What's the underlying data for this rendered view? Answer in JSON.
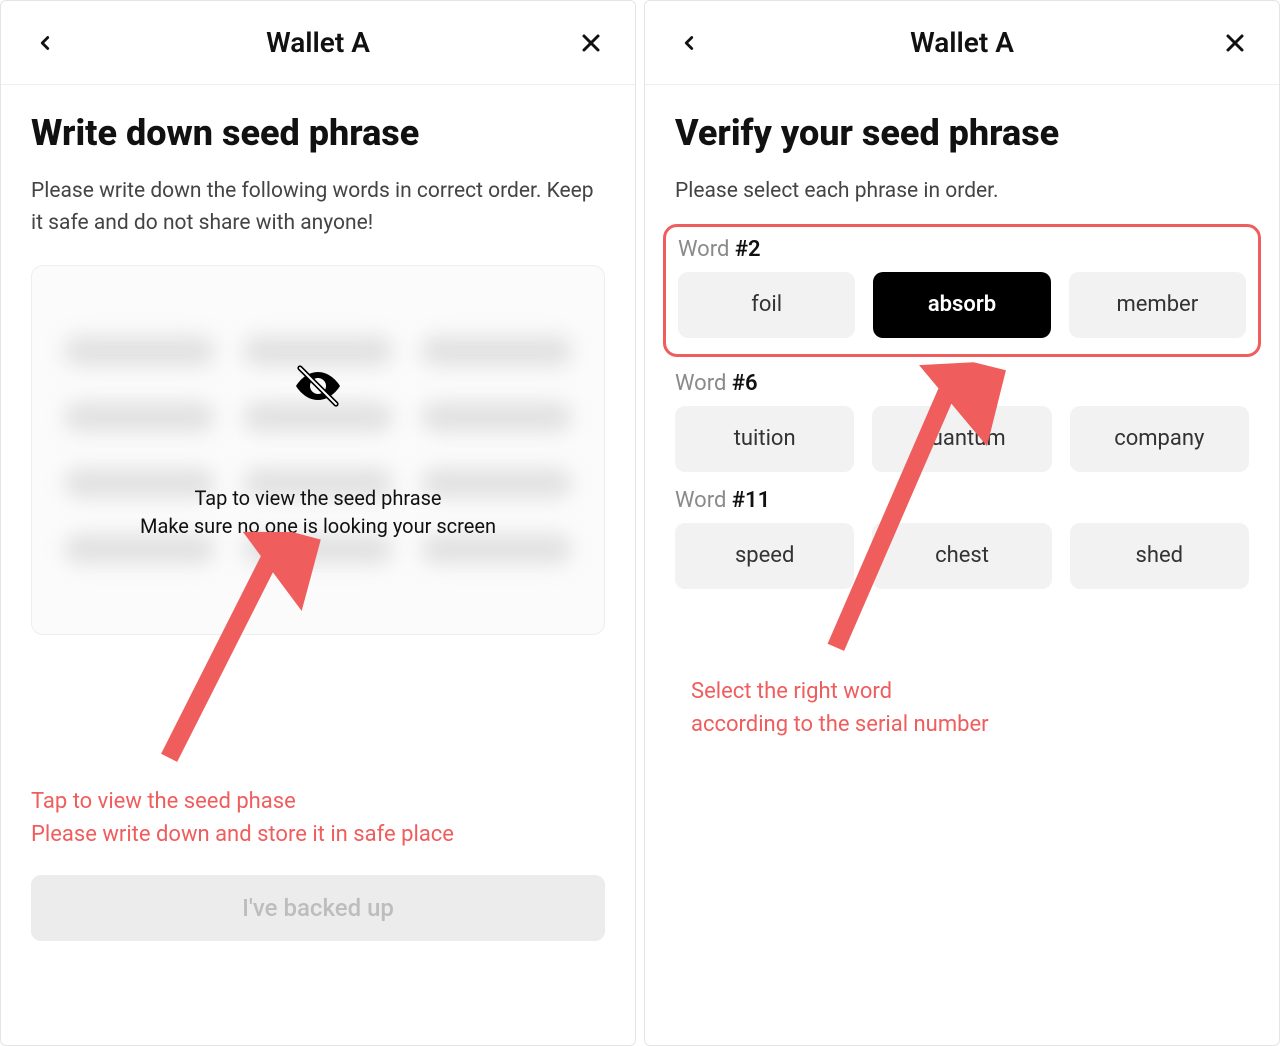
{
  "left": {
    "title": "Wallet A",
    "heading": "Write down seed phrase",
    "subtitle": "Please write down the following words in correct order. Keep it safe and do not share with anyone!",
    "tap_line1": "Tap to view the seed phrase",
    "tap_line2": "Make sure no one is looking your screen",
    "note_line1": "Tap to view the seed phase",
    "note_line2": "Please write down and store it in safe place",
    "button": "I've backed up"
  },
  "right": {
    "title": "Wallet A",
    "heading": "Verify your seed phrase",
    "subtitle": "Please select each phrase in order.",
    "groups": [
      {
        "label_prefix": "Word ",
        "label_num": "#2",
        "options": [
          "foil",
          "absorb",
          "member"
        ],
        "selected": 1,
        "highlight": true
      },
      {
        "label_prefix": "Word ",
        "label_num": "#6",
        "options": [
          "tuition",
          "quantum",
          "company"
        ],
        "selected": -1,
        "highlight": false
      },
      {
        "label_prefix": "Word ",
        "label_num": "#11",
        "options": [
          "speed",
          "chest",
          "shed"
        ],
        "selected": -1,
        "highlight": false
      }
    ],
    "note_line1": "Select the right word",
    "note_line2": "according to the serial number"
  },
  "colors": {
    "accent": "#ef5d5d"
  }
}
